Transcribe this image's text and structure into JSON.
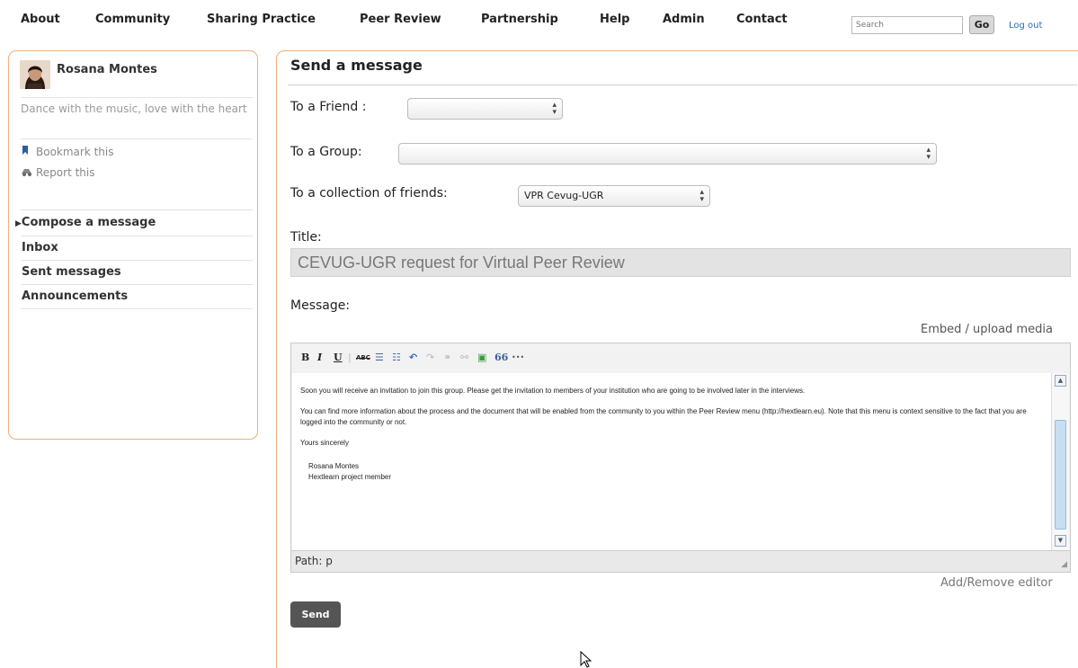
{
  "nav": {
    "items": [
      "About",
      "Community",
      "Sharing Practice",
      "Peer Review",
      "Partnership",
      "Help",
      "Admin",
      "Contact"
    ],
    "search_placeholder": "Search",
    "go_label": "Go",
    "logout_label": "Log out"
  },
  "sidebar": {
    "user_name": "Rosana Montes",
    "motto": "Dance with the music, love with the heart",
    "bookmark_label": "Bookmark this",
    "report_label": "Report this",
    "menu": [
      {
        "label": "Compose a message",
        "active": true,
        "marker": "▶"
      },
      {
        "label": "Inbox"
      },
      {
        "label": "Sent messages"
      },
      {
        "label": "Announcements"
      }
    ]
  },
  "main": {
    "title": "Send a message",
    "to_friend_label": "To a Friend :",
    "to_friend_value": "",
    "to_group_label": "To a Group:",
    "to_group_value": "",
    "to_collection_label": "To a collection of friends:",
    "to_collection_value": "VPR Cevug-UGR",
    "title_label": "Title:",
    "title_value": "CEVUG-UGR request for Virtual Peer Review",
    "message_label": "Message:",
    "embed_label": "Embed / upload media",
    "toolbar": {
      "bold": "B",
      "italic": "I",
      "underline": "U",
      "strikethrough": "ABC",
      "bullet_list": "☰",
      "numbered_list": "☷",
      "undo": "↶",
      "redo": "↷",
      "link": "⚭",
      "unlink": "⚯",
      "image": "▣",
      "blockquote": "66",
      "more": "•••"
    },
    "message_paragraphs": [
      "Soon you will receive an invitation to join this group. Please get the invitation to members of your institution who are going to be involved later in the interviews.",
      "You can find more information about the process and the document that will be enabled from the community to you within the Peer Review menu (http://hextlearn.eu). Note that this menu is context sensitive to the fact that you are logged into the community or not.",
      "Yours sincerely"
    ],
    "signature_name": "Rosana Montes",
    "signature_role": "Hextlearn project member",
    "path_text": "Path: p",
    "toggle_editor_label": "Add/Remove editor",
    "send_label": "Send"
  },
  "colors": {
    "panel_border": "#f0b07a",
    "link": "#2b6cb5",
    "send_button": "#555555",
    "title_input_bg": "#e3e3e3"
  }
}
